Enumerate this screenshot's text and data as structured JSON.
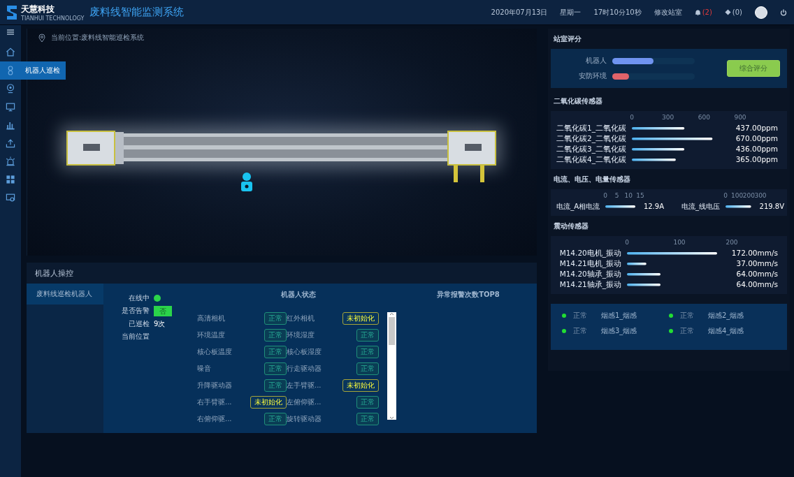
{
  "header": {
    "brand": "天慧科技",
    "brand_sub": "TIANHUI TECHNOLOGY",
    "title": "废料线智能监测系统",
    "date": "2020年07月13日",
    "weekday": "星期一",
    "time": "17时10分10秒",
    "station_link": "修改站室",
    "alarm_count": "(2)",
    "message_count": "(0)"
  },
  "sidebar": {
    "items": [
      {
        "selected": false
      },
      {
        "selected": true,
        "tooltip": "机器人巡检"
      },
      {
        "selected": false
      },
      {
        "selected": false
      },
      {
        "selected": false
      },
      {
        "selected": false
      },
      {
        "selected": false
      },
      {
        "selected": false
      },
      {
        "selected": false
      }
    ]
  },
  "breadcrumb": "当前位置:废料线智能巡检系统",
  "robot_control": {
    "title": "机器人操控",
    "robots": [
      {
        "name": "废料线巡检机器人",
        "selected": true
      }
    ],
    "info": [
      {
        "label": "在线中",
        "kind": "dot",
        "on": true
      },
      {
        "label": "是否告警",
        "kind": "flag",
        "value": "否",
        "on": false
      },
      {
        "label": "已巡检",
        "kind": "text",
        "value": "9次"
      },
      {
        "label": "当前位置",
        "kind": "text"
      }
    ],
    "status_title": "机器人状态",
    "status": [
      {
        "name": "高清相机",
        "value": "正常",
        "kind": "ok"
      },
      {
        "name": "红外相机",
        "value": "未初始化",
        "kind": "warn"
      },
      {
        "name": "环境温度",
        "value": "正常",
        "kind": "ok"
      },
      {
        "name": "环境湿度",
        "value": "正常",
        "kind": "ok"
      },
      {
        "name": "核心板温度",
        "value": "正常",
        "kind": "ok"
      },
      {
        "name": "核心板湿度",
        "value": "正常",
        "kind": "ok"
      },
      {
        "name": "噪音",
        "value": "正常",
        "kind": "ok"
      },
      {
        "name": "行走驱动器",
        "value": "正常",
        "kind": "ok"
      },
      {
        "name": "升降驱动器",
        "value": "正常",
        "kind": "ok"
      },
      {
        "name": "左手臂驱...",
        "value": "未初始化",
        "kind": "warn"
      },
      {
        "name": "右手臂驱...",
        "value": "未初始化",
        "kind": "warn"
      },
      {
        "name": "左俯仰驱...",
        "value": "正常",
        "kind": "ok"
      },
      {
        "name": "右俯仰驱...",
        "value": "正常",
        "kind": "ok"
      },
      {
        "name": "旋转驱动器",
        "value": "正常",
        "kind": "ok"
      }
    ],
    "top_title": "异常报警次数TOP8"
  },
  "station_score": {
    "title": "站室评分",
    "bars": [
      {
        "label": "机器人",
        "level": 0.5,
        "color": "#6f93f0"
      },
      {
        "label": "安防环境",
        "level": 0.2,
        "color": "#e0636a"
      }
    ],
    "button": "综合评分"
  },
  "co2": {
    "title": "二氧化碳传感器",
    "chart_data": {
      "type": "bar",
      "orientation": "horizontal",
      "categories": [
        "二氧化碳1_二氧化碳",
        "二氧化碳2_二氧化碳",
        "二氧化碳3_二氧化碳",
        "二氧化碳4_二氧化碳"
      ],
      "series": [
        {
          "color": "#4fb3f0",
          "values": [
            437,
            670,
            436,
            365
          ]
        }
      ],
      "xlim": [
        0,
        900
      ],
      "xticks": [
        0,
        300,
        600,
        900
      ],
      "value_labels": [
        "437.00ppm",
        "670.00ppm",
        "436.00ppm",
        "365.00ppm"
      ]
    }
  },
  "power": {
    "title": "电流、电压、电量传感器",
    "charts": [
      {
        "chart_data": {
          "type": "bar",
          "orientation": "horizontal",
          "categories": [
            "电流_A相电流"
          ],
          "series": [
            {
              "color": "#4fb3f0",
              "values": [
                12.9
              ]
            }
          ],
          "xlim": [
            0,
            15
          ],
          "xticks": [
            0,
            5,
            10,
            15
          ],
          "value_labels": [
            "12.9A"
          ]
        }
      },
      {
        "chart_data": {
          "type": "bar",
          "orientation": "horizontal",
          "categories": [
            "电流_线电压"
          ],
          "series": [
            {
              "color": "#4fb3f0",
              "values": [
                219.8
              ]
            }
          ],
          "xlim": [
            0,
            300
          ],
          "xticks": [
            0,
            100,
            200,
            300
          ],
          "value_labels": [
            "219.8V"
          ]
        }
      }
    ]
  },
  "vibration": {
    "title": "震动传感器",
    "chart_data": {
      "type": "bar",
      "orientation": "horizontal",
      "categories": [
        "M14.20电机_振动",
        "M14.21电机_振动",
        "M14.20轴承_振动",
        "M14.21轴承_振动"
      ],
      "series": [
        {
          "color": "#4fb3f0",
          "values": [
            172,
            37,
            64,
            64
          ]
        }
      ],
      "xlim": [
        0,
        200
      ],
      "xticks": [
        0,
        100,
        200
      ],
      "value_labels": [
        "172.00mm/s",
        "37.00mm/s",
        "64.00mm/s",
        "64.00mm/s"
      ]
    }
  },
  "smoke": [
    {
      "status": "正常",
      "name": "烟感1_烟感",
      "color": "#22dd33"
    },
    {
      "status": "正常",
      "name": "烟感2_烟感",
      "color": "#22dd33"
    },
    {
      "status": "正常",
      "name": "烟感3_烟感",
      "color": "#22dd33"
    },
    {
      "status": "正常",
      "name": "烟感4_烟感",
      "color": "#22dd33"
    }
  ]
}
